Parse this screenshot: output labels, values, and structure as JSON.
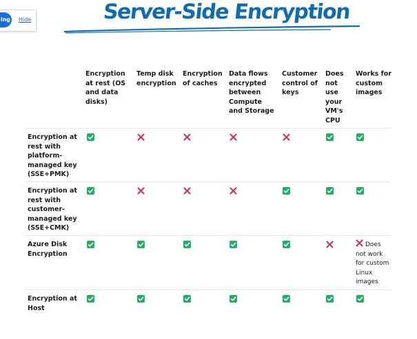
{
  "popup": {
    "pill_label": "ing",
    "hide_label": "Hide"
  },
  "title": "Server-Side Encryption",
  "columns": [
    "Encryption at rest (OS and data disks)",
    "Temp disk encryption",
    "Encryption of caches",
    "Data flows encrypted between Compute and Storage",
    "Customer control of keys",
    "Does not use your VM's CPU",
    "Works for custom images"
  ],
  "rows": [
    {
      "label": "Encryption at rest with platform-managed key (SSE+PMK)",
      "cells": [
        "check",
        "cross",
        "cross",
        "cross",
        "cross",
        "check",
        "check"
      ]
    },
    {
      "label": "Encryption at rest with customer-managed key (SSE+CMK)",
      "cells": [
        "check",
        "cross",
        "cross",
        "cross",
        "check",
        "check",
        "check"
      ]
    },
    {
      "label": "Azure Disk Encryption",
      "cells": [
        "check",
        "check",
        "check",
        "check",
        "check",
        "cross",
        "cross"
      ],
      "note": "Does not work for custom Linux images"
    },
    {
      "label": "Encryption at Host",
      "cells": [
        "check",
        "check",
        "check",
        "check",
        "check",
        "check",
        "check"
      ]
    }
  ],
  "colors": {
    "title": "#0f6bb3",
    "check": "#1fb063",
    "cross": "#d1345b",
    "pill": "#1b6fd8",
    "link": "#2459c9"
  },
  "icons": {
    "check": "check-icon",
    "cross": "cross-icon"
  }
}
